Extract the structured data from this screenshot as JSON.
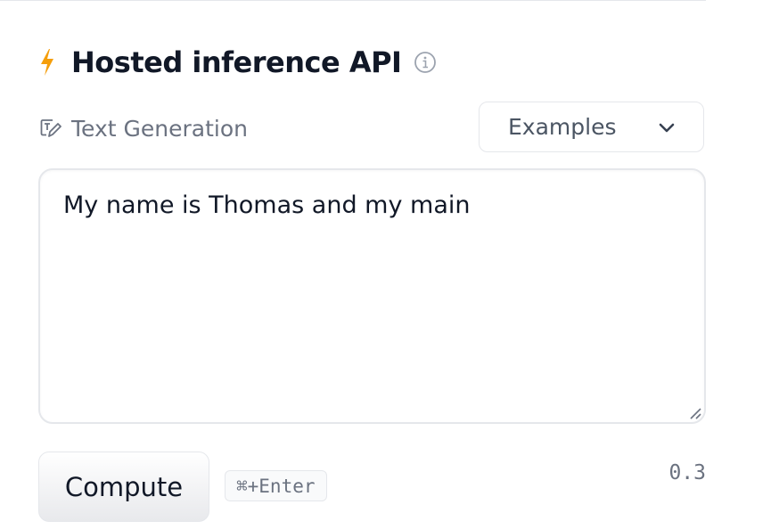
{
  "header": {
    "title": "Hosted inference API",
    "bolt_icon": "lightning-bolt-icon",
    "info_icon": "info-circle-icon",
    "accent_color": "#f59e0b"
  },
  "task": {
    "icon": "text-generation-icon",
    "label": "Text Generation"
  },
  "examples_dropdown": {
    "label": "Examples",
    "icon": "chevron-down-icon"
  },
  "input": {
    "value": "My name is Thomas and my main"
  },
  "compute_button": {
    "label": "Compute"
  },
  "shortcut": {
    "label": "⌘+Enter"
  },
  "status": {
    "value": "0.3"
  }
}
